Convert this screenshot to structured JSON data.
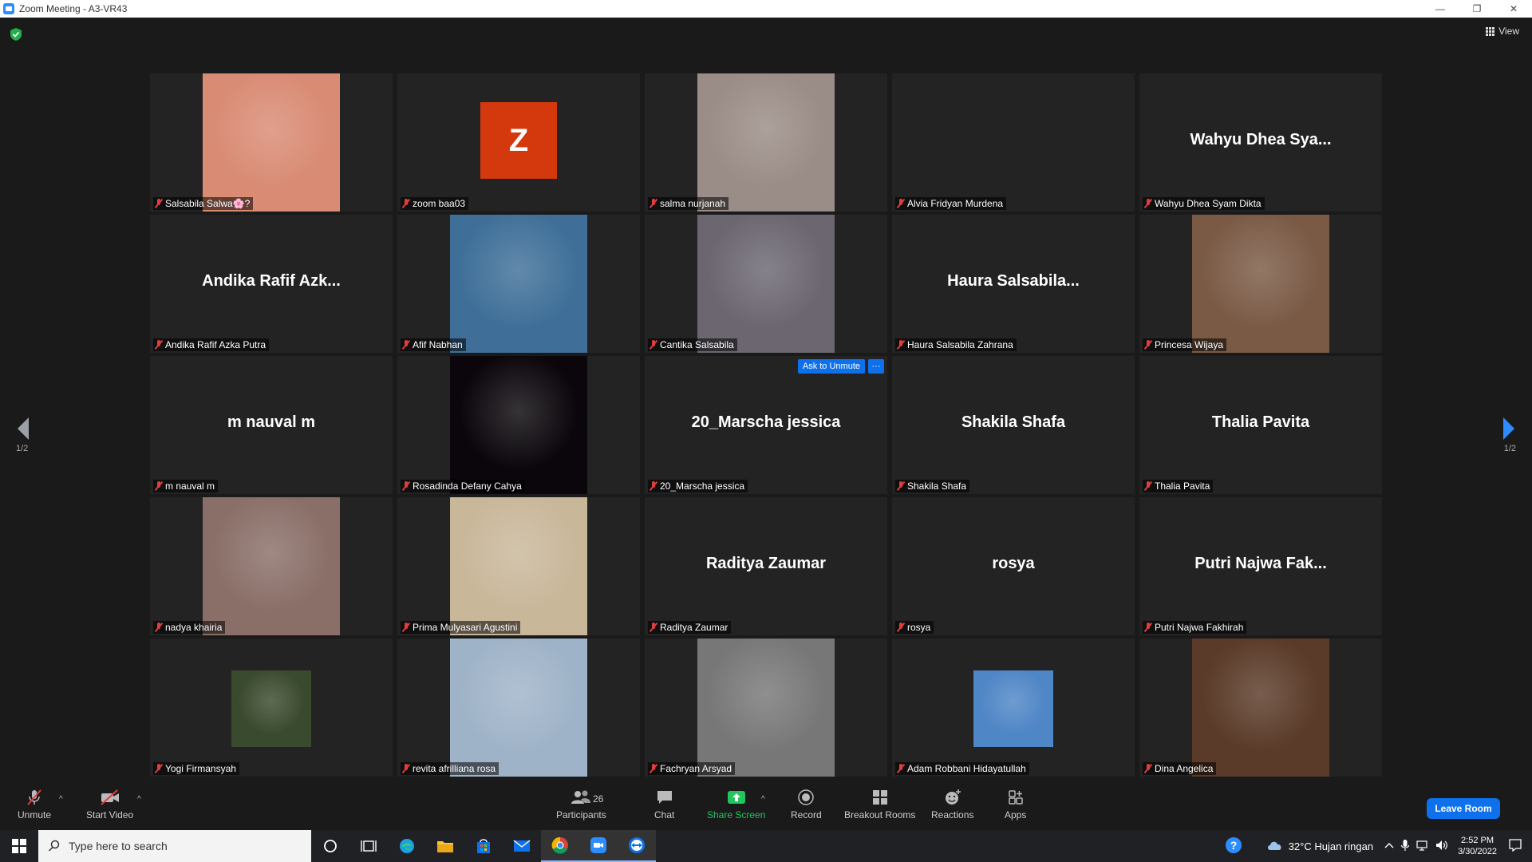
{
  "window": {
    "title": "Zoom Meeting - A3-VR43",
    "minimize": "—",
    "restore": "❐",
    "close": "✕"
  },
  "meeting": {
    "view_label": "View",
    "page_left": "1/2",
    "page_right": "1/2",
    "ask_to_unmute": "Ask to Unmute",
    "more": "···",
    "avatar_letter": "Z"
  },
  "tiles": [
    {
      "name": "Salsabila Salwa🌸?",
      "big": "",
      "type": "photo",
      "color": "#d98b74"
    },
    {
      "name": "zoom baa03",
      "big": "",
      "type": "avatar",
      "color": "#d4380d"
    },
    {
      "name": "salma nurjanah",
      "big": "",
      "type": "photo",
      "color": "#9a8c86"
    },
    {
      "name": "Alvia Fridyan Murdena",
      "big": "",
      "type": "empty",
      "color": "#232323"
    },
    {
      "name": "Wahyu Dhea Syam Dikta",
      "big": "Wahyu Dhea Sya...",
      "type": "name",
      "color": "#232323"
    },
    {
      "name": "Andika Rafif Azka Putra",
      "big": "Andika Rafif Azk...",
      "type": "name",
      "color": "#232323"
    },
    {
      "name": "Afif Nabhan",
      "big": "",
      "type": "photo",
      "color": "#3f6f98"
    },
    {
      "name": "Cantika Salsabila",
      "big": "",
      "type": "photo",
      "color": "#6b6670"
    },
    {
      "name": "Haura Salsabila Zahrana",
      "big": "Haura Salsabila...",
      "type": "name",
      "color": "#232323"
    },
    {
      "name": "Princesa Wijaya",
      "big": "",
      "type": "photo",
      "color": "#7a5a45"
    },
    {
      "name": "m nauval m",
      "big": "m nauval m",
      "type": "name",
      "color": "#232323"
    },
    {
      "name": "Rosadinda Defany Cahya",
      "big": "",
      "type": "photo",
      "color": "#0a060b"
    },
    {
      "name": "20_Marscha jessica",
      "big": "20_Marscha jessica",
      "type": "name-ask",
      "color": "#232323"
    },
    {
      "name": "Shakila Shafa",
      "big": "Shakila Shafa",
      "type": "name",
      "color": "#232323"
    },
    {
      "name": "Thalia Pavita",
      "big": "Thalia Pavita",
      "type": "name",
      "color": "#232323"
    },
    {
      "name": "nadya khairia",
      "big": "",
      "type": "photo",
      "color": "#8a6f68"
    },
    {
      "name": "Prima Mulyasari Agustini",
      "big": "",
      "type": "photo",
      "color": "#c9b79a"
    },
    {
      "name": "Raditya Zaumar",
      "big": "Raditya Zaumar",
      "type": "name",
      "color": "#232323"
    },
    {
      "name": "rosya",
      "big": "rosya",
      "type": "name",
      "color": "#232323"
    },
    {
      "name": "Putri Najwa Fakhirah",
      "big": "Putri Najwa Fak...",
      "type": "name",
      "color": "#232323"
    },
    {
      "name": "Yogi Firmansyah",
      "big": "",
      "type": "photo-small",
      "color": "#3a4a2e"
    },
    {
      "name": "revita afrilliana rosa",
      "big": "",
      "type": "photo",
      "color": "#9fb3c8"
    },
    {
      "name": "Fachryan Arsyad",
      "big": "",
      "type": "photo",
      "color": "#777777"
    },
    {
      "name": "Adam Robbani Hidayatullah",
      "big": "",
      "type": "photo-small",
      "color": "#4f86c6"
    },
    {
      "name": "Dina Angelica",
      "big": "",
      "type": "photo",
      "color": "#5a3a28"
    }
  ],
  "toolbar": {
    "unmute": "Unmute",
    "start_video": "Start Video",
    "participants": "Participants",
    "participants_count": "26",
    "chat": "Chat",
    "share_screen": "Share Screen",
    "record": "Record",
    "breakout_rooms": "Breakout Rooms",
    "reactions": "Reactions",
    "apps": "Apps",
    "leave_room": "Leave Room",
    "caret": "^"
  },
  "taskbar": {
    "search_placeholder": "Type here to search",
    "weather": "32°C  Hujan ringan",
    "time": "2:52 PM",
    "date": "3/30/2022"
  },
  "colors": {
    "accent": "#0e71eb",
    "share_green": "#22c55e",
    "mute_red": "#e03e3e",
    "background": "#1a1a1a",
    "tile": "#232323"
  }
}
